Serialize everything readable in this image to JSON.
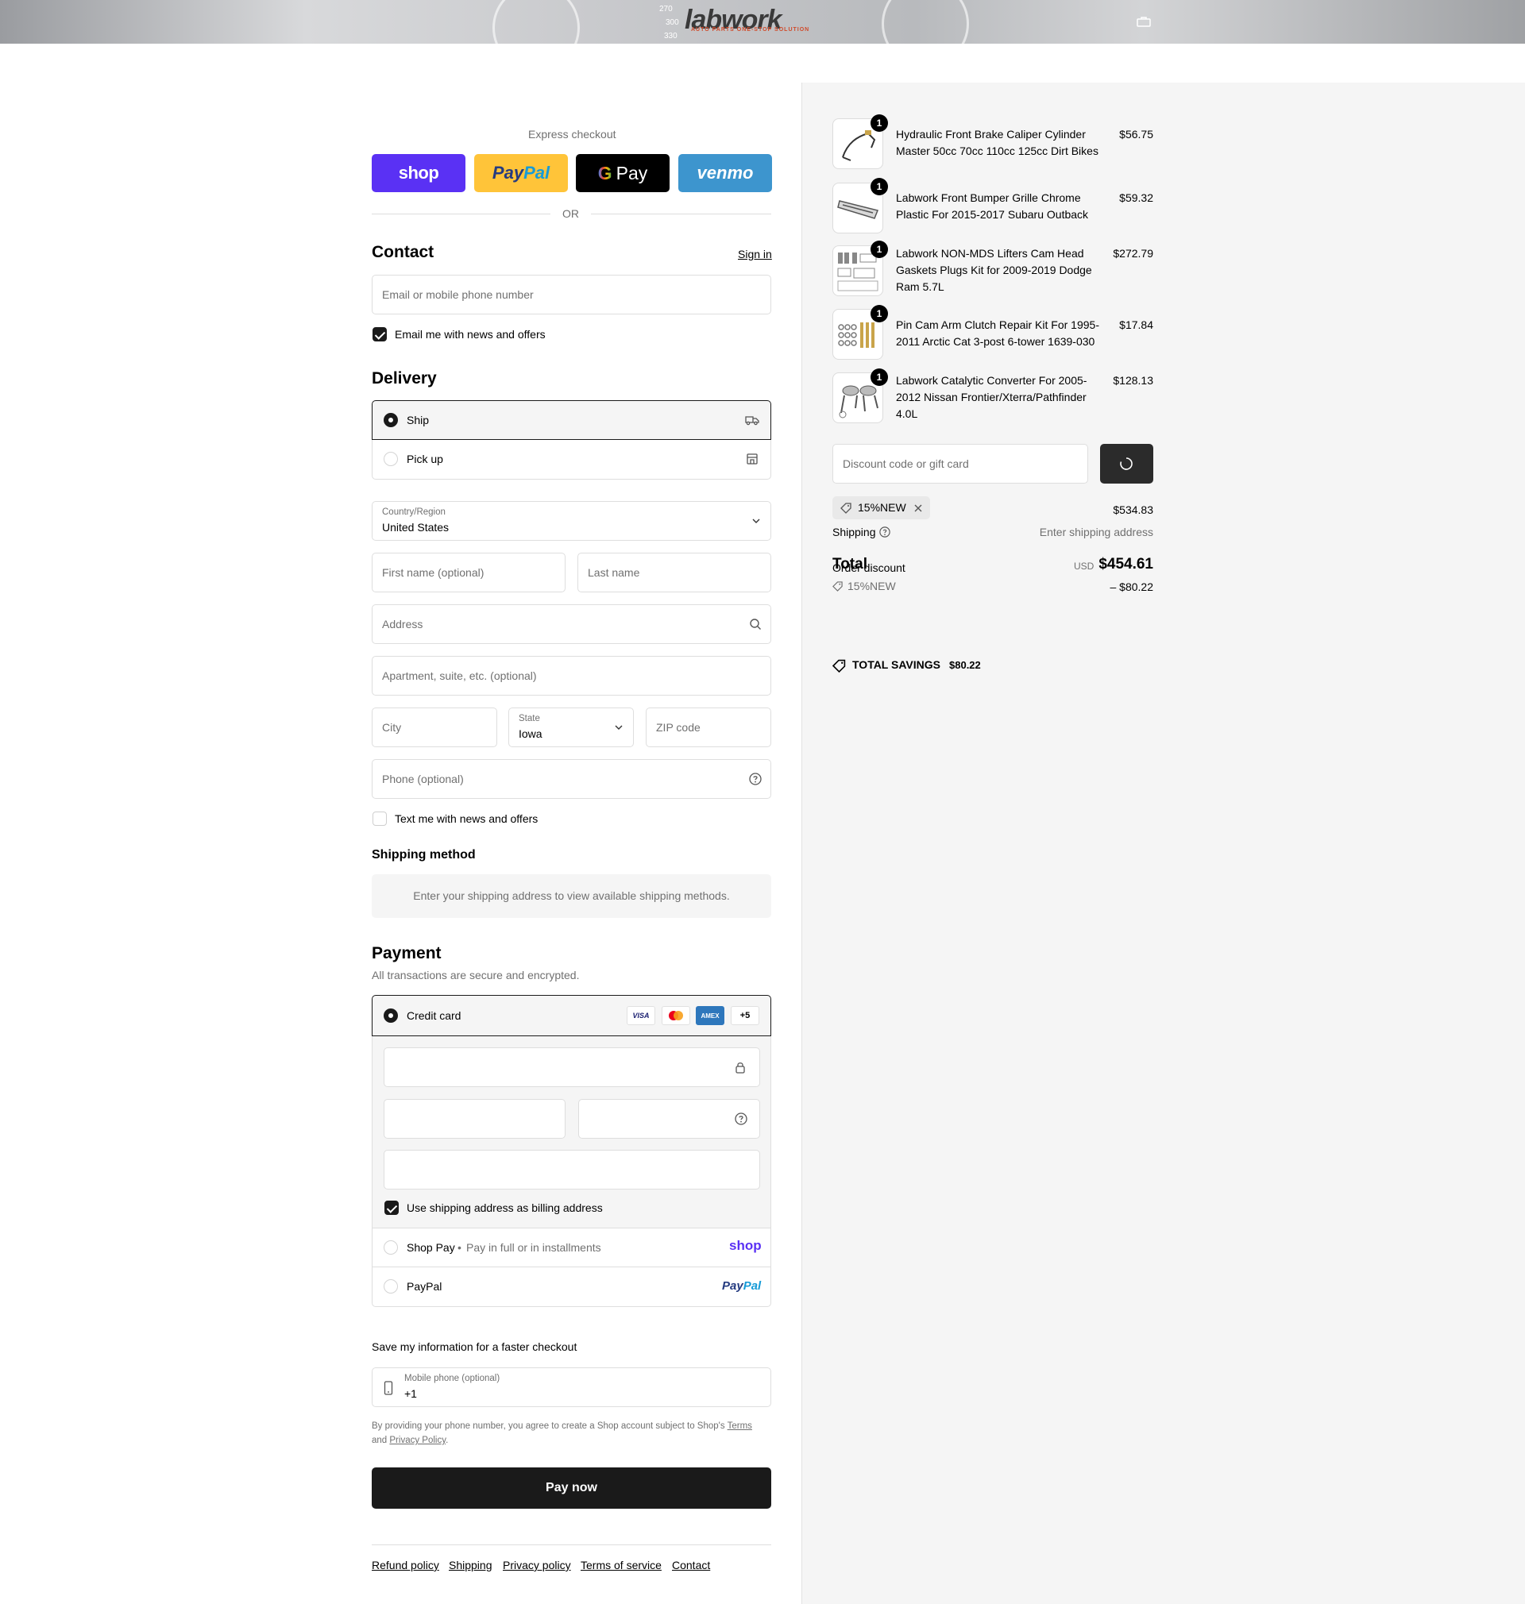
{
  "brand": {
    "logo_text": "labwork",
    "tagline": "AUTO PARTS ONE-STOP SOLUTION",
    "gauge_numbers": [
      "270",
      "300",
      "330"
    ]
  },
  "express": {
    "heading": "Express checkout",
    "shop_label": "shop",
    "paypal_label": "PayPal",
    "gpay_label": "Pay",
    "venmo_label": "venmo",
    "or_label": "OR"
  },
  "contact": {
    "title": "Contact",
    "sign_in": "Sign in",
    "email_placeholder": "Email or mobile phone number",
    "news_label": "Email me with news and offers",
    "news_checked": true
  },
  "delivery": {
    "title": "Delivery",
    "options": [
      {
        "label": "Ship",
        "selected": true,
        "icon": "truck-icon"
      },
      {
        "label": "Pick up",
        "selected": false,
        "icon": "store-icon"
      }
    ],
    "country_label": "Country/Region",
    "country_value": "United States",
    "first_name_placeholder": "First name (optional)",
    "last_name_placeholder": "Last name",
    "address_placeholder": "Address",
    "apartment_placeholder": "Apartment, suite, etc. (optional)",
    "city_placeholder": "City",
    "state_label": "State",
    "state_value": "Iowa",
    "zip_placeholder": "ZIP code",
    "phone_placeholder": "Phone (optional)",
    "sms_label": "Text me with news and offers",
    "sms_checked": false
  },
  "shipping_method": {
    "title": "Shipping method",
    "notice": "Enter your shipping address to view available shipping methods."
  },
  "payment": {
    "title": "Payment",
    "subtitle": "All transactions are secure and encrypted.",
    "credit_card_label": "Credit card",
    "card_brands": [
      "VISA",
      "Mastercard",
      "AMEX"
    ],
    "more_brands": "+5",
    "billing_label": "Use shipping address as billing address",
    "billing_checked": true,
    "shop_pay_label": "Shop Pay",
    "shop_pay_sub": "Pay in full or in installments",
    "shop_pay_logo": "shop",
    "paypal_label": "PayPal",
    "paypal_logo": "PayPal"
  },
  "remember": {
    "title": "Save my information for a faster checkout",
    "phone_label": "Mobile phone (optional)",
    "phone_value": "+1",
    "disclaimer_pre": "By providing your phone number, you agree to create a Shop account subject to Shop's ",
    "terms_link": "Terms",
    "disclaimer_mid": "and ",
    "privacy_link": "Privacy Policy",
    "disclaimer_end": "."
  },
  "pay_button": "Pay now",
  "footer_links": [
    "Refund policy",
    "Shipping",
    "Privacy policy",
    "Terms of service",
    "Contact"
  ],
  "summary": {
    "items": [
      {
        "qty": "1",
        "title": "Hydraulic Front Brake Caliper Cylinder Master 50cc 70cc 110cc 125cc Dirt Bikes",
        "price": "$56.75"
      },
      {
        "qty": "1",
        "title": "Labwork Front Bumper Grille Chrome Plastic For 2015-2017 Subaru Outback",
        "price": "$59.32"
      },
      {
        "qty": "1",
        "title": "Labwork NON-MDS Lifters Cam Head Gaskets Plugs Kit for 2009-2019 Dodge Ram 5.7L",
        "price": "$272.79"
      },
      {
        "qty": "1",
        "title": "Pin Cam Arm Clutch Repair Kit For 1995-2011 Arctic Cat 3-post 6-tower 1639-030",
        "price": "$17.84"
      },
      {
        "qty": "1",
        "title": "Labwork Catalytic Converter For 2005-2012 Nissan Frontier/Xterra/Pathfinder 4.0L",
        "price": "$128.13"
      }
    ],
    "discount_placeholder": "Discount code or gift card",
    "applied_code": "15%NEW",
    "subtotal": "$534.83",
    "shipping_label": "Shipping",
    "shipping_value": "Enter shipping address",
    "order_discount_label": "Order discount",
    "order_discount_code": "15%NEW",
    "order_discount_value": "– $80.22",
    "total_label": "Total",
    "currency": "USD",
    "total_value": "$454.61",
    "savings_label": "TOTAL SAVINGS",
    "savings_value": "$80.22"
  },
  "colors": {
    "shop_pay": "#5a31f4",
    "paypal_yellow": "#ffc439",
    "venmo_blue": "#3d95ce",
    "primary_dark": "#1a1a1a"
  }
}
